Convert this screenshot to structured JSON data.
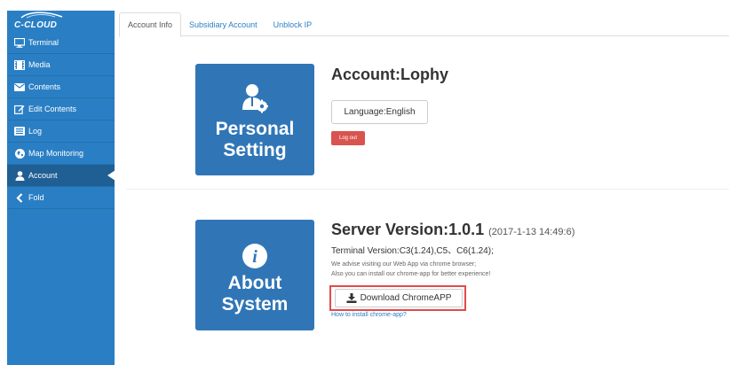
{
  "brand": {
    "logo_text": "C-CLOUD"
  },
  "sidebar": {
    "items": [
      {
        "label": "Terminal",
        "icon": "monitor-icon"
      },
      {
        "label": "Media",
        "icon": "film-icon"
      },
      {
        "label": "Contents",
        "icon": "envelope-icon"
      },
      {
        "label": "Edit Contents",
        "icon": "edit-icon"
      },
      {
        "label": "Log",
        "icon": "list-icon"
      },
      {
        "label": "Map Monitoring",
        "icon": "globe-icon"
      },
      {
        "label": "Account",
        "icon": "user-icon",
        "active": true
      },
      {
        "label": "Fold",
        "icon": "chevron-left-icon"
      }
    ]
  },
  "tabs": [
    {
      "label": "Account Info",
      "active": true
    },
    {
      "label": "Subsidiary Account"
    },
    {
      "label": "Unblock IP"
    }
  ],
  "personal": {
    "tile_line1": "Personal",
    "tile_line2": "Setting",
    "account_title": "Account:Lophy",
    "language_button": "Language:English",
    "logout_button": "Log out"
  },
  "about": {
    "tile_line1": "About",
    "tile_line2": "System",
    "server_version": "Server Version:1.0.1",
    "server_date": "(2017-1-13 14:49:6)",
    "terminal_version": "Terminal Version:C3(1.24),C5、C6(1.24);",
    "advise_line1": "We advise visiting our Web App via chrome browser;",
    "advise_line2": "Also you can install our chrome-app for better experience!",
    "download_button": "Download ChromeAPP",
    "howto_link": "How to install chrome-app?"
  },
  "colors": {
    "sidebar": "#2a7fc4",
    "sidebar_active": "#1f5f94",
    "tile": "#3076b7",
    "logout": "#d9534f",
    "highlight": "#e24b4b",
    "link": "#2a7fc4"
  }
}
